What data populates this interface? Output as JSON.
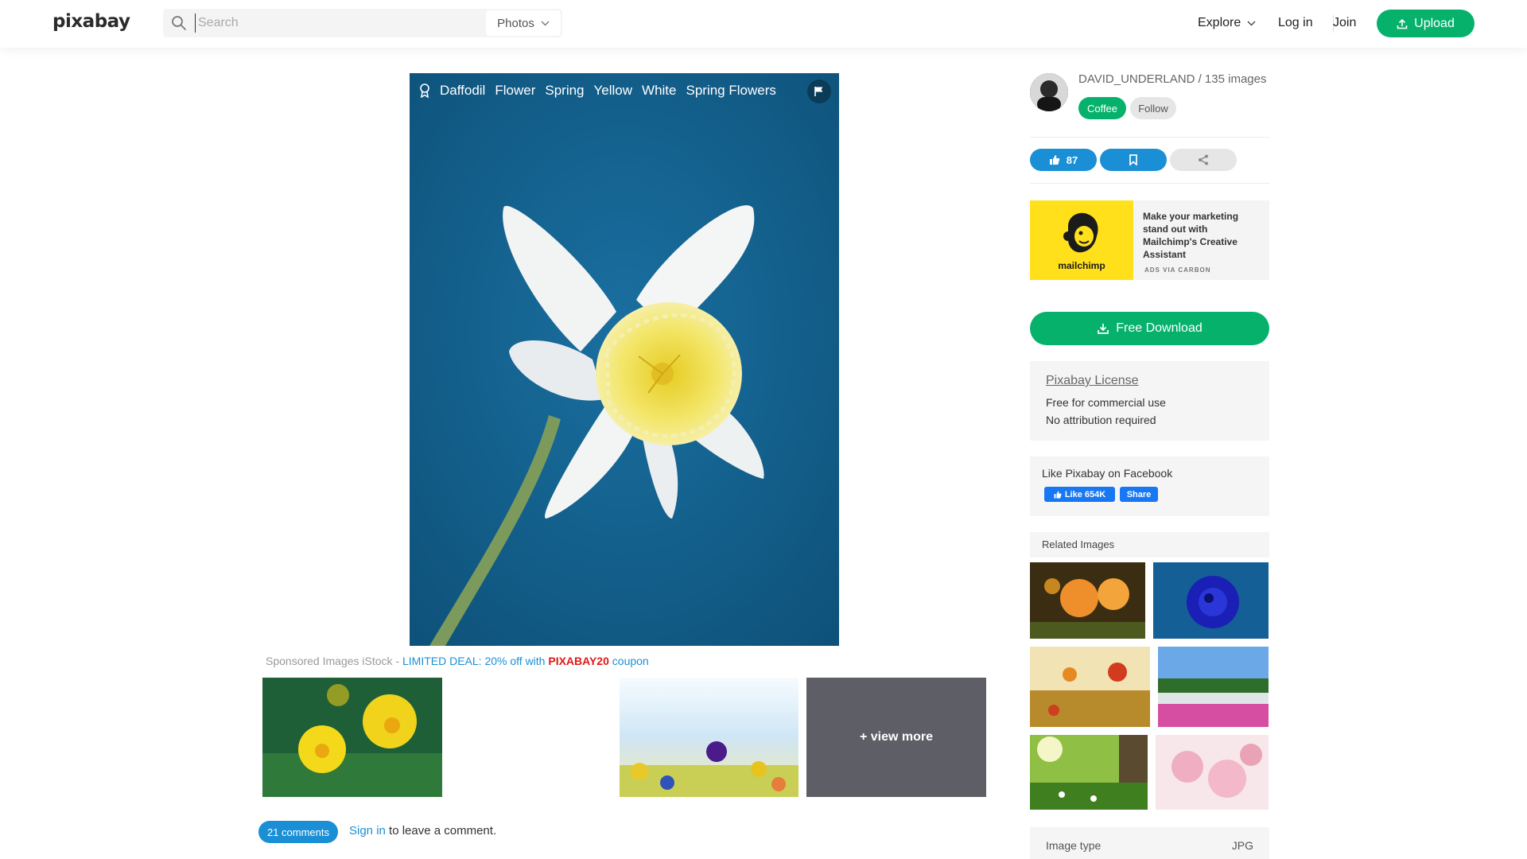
{
  "header": {
    "logo": "pixabay",
    "search_placeholder": "Search",
    "search_type": "Photos",
    "explore": "Explore",
    "login": "Log in",
    "join": "Join",
    "upload": "Upload"
  },
  "image": {
    "tags": [
      "Daffodil",
      "Flower",
      "Spring",
      "Yellow",
      "White",
      "Spring Flowers"
    ]
  },
  "sponsored": {
    "label": "Sponsored Images iStock - ",
    "deal": "LIMITED DEAL: 20% off with ",
    "code": "PIXABAY20",
    "coupon": " coupon",
    "view_more": "+ view more"
  },
  "comments": {
    "count": "21 comments",
    "signin": "Sign in",
    "rest": " to leave a comment."
  },
  "sidebar": {
    "author": "DAVID_UNDERLAND / 135 images",
    "coffee": "Coffee",
    "follow": "Follow",
    "likes": "87",
    "ad": {
      "brand": "mailchimp",
      "text": "Make your marketing stand out with Mailchimp's Creative Assistant",
      "via": "ADS VIA CARBON"
    },
    "download": "Free Download",
    "license": {
      "title": "Pixabay License",
      "line1": "Free for commercial use",
      "line2": "No attribution required"
    },
    "facebook": {
      "title": "Like Pixabay on Facebook",
      "like": "Like 654K",
      "share": "Share"
    },
    "related_title": "Related Images",
    "meta": {
      "label": "Image type",
      "value": "JPG"
    }
  },
  "colors": {
    "brand_green": "#06b26b",
    "link_blue": "#1a8fd6",
    "coupon_red": "#e01818",
    "image_bg": "#16628e"
  }
}
